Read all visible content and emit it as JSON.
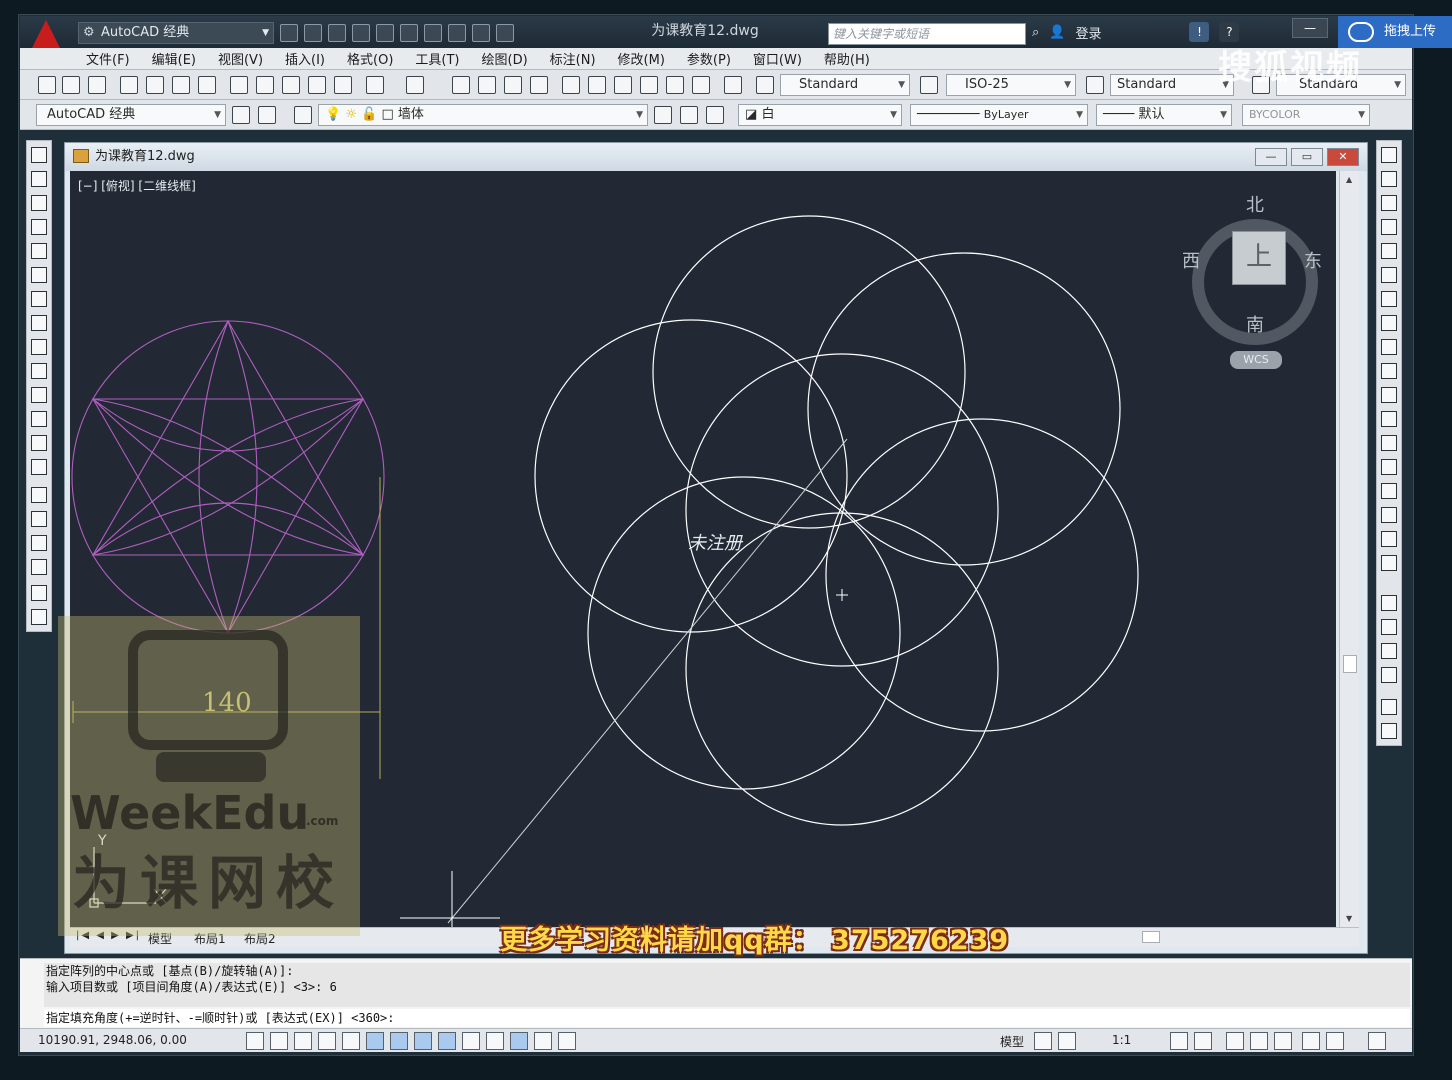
{
  "app": {
    "workspace": "AutoCAD 经典",
    "document_title": "为课教育12.dwg",
    "search_placeholder": "键入关键字或短语",
    "login": "登录",
    "upload_label": "拖拽上传"
  },
  "menu": [
    "文件(F)",
    "编辑(E)",
    "视图(V)",
    "插入(I)",
    "格式(O)",
    "工具(T)",
    "绘图(D)",
    "标注(N)",
    "修改(M)",
    "参数(P)",
    "窗口(W)",
    "帮助(H)"
  ],
  "toolbar1": {
    "text_style": "Standard",
    "dim_style": "ISO-25",
    "table_style": "Standard",
    "mleader_style": "Standard"
  },
  "toolbar2": {
    "workspace": "AutoCAD 经典",
    "layer": "墙体",
    "color": "白",
    "linetype": "ByLayer",
    "lineweight": "默认",
    "plot_style": "BYCOLOR"
  },
  "drawing": {
    "window_title": "为课教育12.dwg",
    "viewport_label": "[−] [俯视] [二维线框]",
    "dimension_value": "140",
    "cursor_tooltip": "未注册",
    "tabs": [
      "模型",
      "布局1",
      "布局2"
    ],
    "ucs": {
      "y_label": "Y"
    }
  },
  "viewcube": {
    "north": "北",
    "south": "南",
    "east": "东",
    "west": "西",
    "face": "上",
    "wcs": "WCS"
  },
  "command": {
    "history": [
      "指定阵列的中心点或 [基点(B)/旋转轴(A)]:",
      "输入项目数或 [项目间角度(A)/表达式(E)] <3>: 6"
    ],
    "current": "指定填充角度(+=逆时针、-=顺时针)或 [表达式(EX)] <360>:"
  },
  "status": {
    "coordinates": "10190.91, 2948.06, 0.00",
    "model_label": "模型",
    "scale": "1:1"
  },
  "overlays": {
    "promo": "更多学习资料请加qq群： 375276239",
    "watermark_site": "搜狐视频",
    "watermark_brand": "WeekEdu",
    "watermark_brand_suffix": ".com",
    "watermark_cn": "为课网校"
  },
  "colors": {
    "canvas": "#222834",
    "drawing_lines": "#ffffff",
    "magenta_lines": "#b05fc0",
    "dimension": "#b4b05a",
    "promo": "#ffd84a"
  }
}
